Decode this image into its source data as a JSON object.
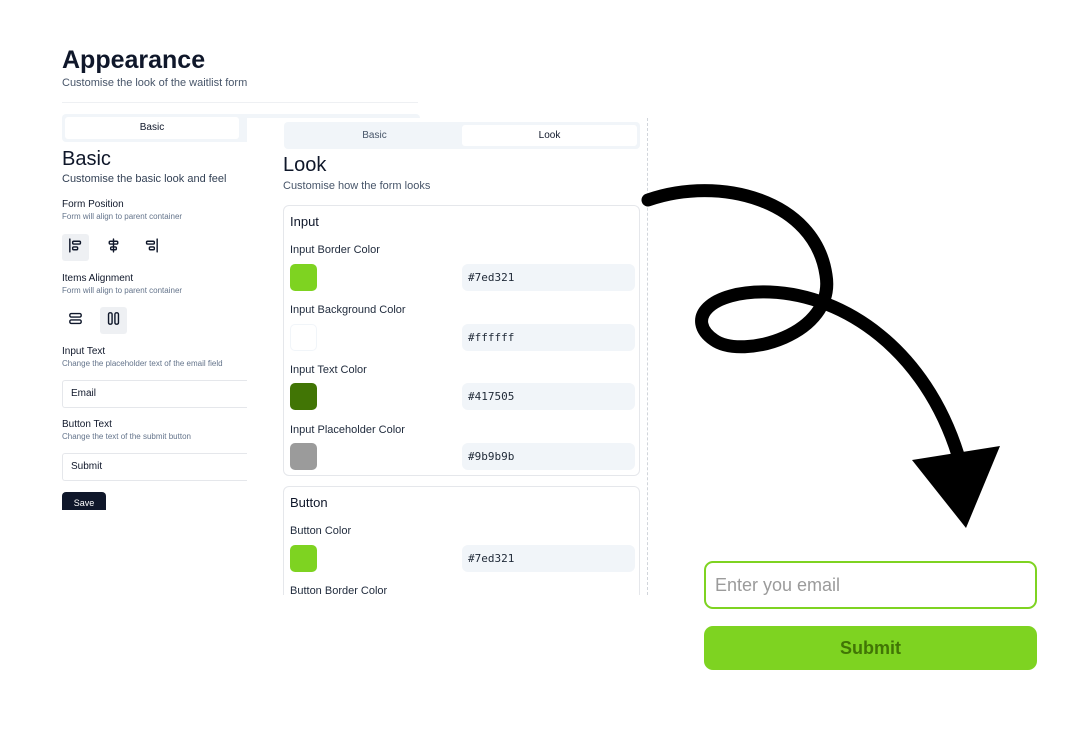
{
  "header": {
    "title": "Appearance",
    "subtitle": "Customise the look of the waitlist form"
  },
  "basic_panel": {
    "tab_basic": "Basic",
    "section_title": "Basic",
    "section_subtitle": "Customise the basic look and feel",
    "form_position": {
      "label": "Form Position",
      "hint": "Form will align to parent container",
      "options": [
        "align-left-icon",
        "align-center-icon",
        "align-right-icon"
      ],
      "selected": "align-left-icon"
    },
    "items_alignment": {
      "label": "Items Alignment",
      "hint": "Form will align to parent container",
      "options": [
        "stack-vertical-icon",
        "stack-horizontal-icon"
      ],
      "selected": "stack-horizontal-icon"
    },
    "input_text": {
      "label": "Input Text",
      "hint": "Change the placeholder text of the email field",
      "value": "Email"
    },
    "button_text": {
      "label": "Button Text",
      "hint": "Change the text of the submit button",
      "value": "Submit"
    },
    "save_label": "Save"
  },
  "look_panel": {
    "tab_basic": "Basic",
    "tab_look": "Look",
    "active_tab": "Look",
    "section_title": "Look",
    "section_subtitle": "Customise how the form looks",
    "input_card": {
      "title": "Input",
      "fields": [
        {
          "label": "Input Border Color",
          "value": "#7ed321"
        },
        {
          "label": "Input Background Color",
          "value": "#ffffff"
        },
        {
          "label": "Input Text Color",
          "value": "#417505"
        },
        {
          "label": "Input Placeholder Color",
          "value": "#9b9b9b"
        }
      ]
    },
    "button_card": {
      "title": "Button",
      "fields": [
        {
          "label": "Button Color",
          "value": "#7ed321"
        },
        {
          "label": "Button Border Color",
          "value": ""
        }
      ]
    }
  },
  "preview": {
    "email_placeholder": "Enter you email",
    "submit_label": "Submit"
  },
  "colors": {
    "brand_green": "#7ed321",
    "dark_green": "#417505",
    "placeholder_gray": "#9b9b9b",
    "ink": "#0f172a"
  }
}
